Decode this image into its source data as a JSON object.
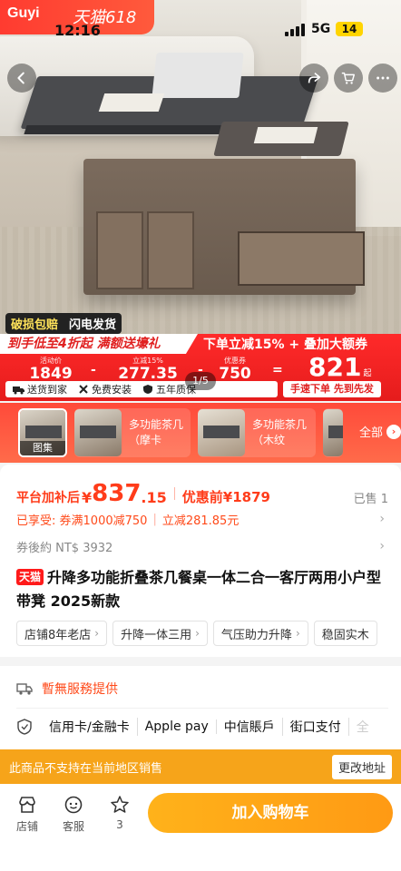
{
  "status_bar": {
    "brand": "Guyi",
    "brand_sub": "天猫618",
    "time": "12:16",
    "network": "5G",
    "battery": "14"
  },
  "hero": {
    "tag_primary": "破损包赔",
    "tag_secondary": "闪电发货",
    "page_indicator": "1/5"
  },
  "promo": {
    "headline_left": "到手低至4折起 满额送壕礼",
    "headline_right": "下单立减15% + 叠加大额券",
    "calc": {
      "activity_label": "活动价",
      "activity_value": "1849",
      "minus1": "-",
      "discount_label": "立减15%",
      "discount_value": "277.35",
      "minus2": "-",
      "coupon_label": "优惠券",
      "coupon_value": "750",
      "equals": "=",
      "final_value": "821",
      "final_unit": "起"
    },
    "perks": [
      "送货到家",
      "免费安装",
      "五年质保"
    ],
    "slogan": "手速下单 先到先发"
  },
  "thumbnails": {
    "first_badge": "图集",
    "items": [
      {
        "caption": "多功能茶几（摩卡"
      },
      {
        "caption": "多功能茶几（木纹"
      }
    ],
    "all_label": "全部"
  },
  "price": {
    "prefix": "平台加补后",
    "symbol": "¥",
    "integer": "837",
    "decimal": ".15",
    "original": "优惠前¥1879",
    "sold": "已售 1"
  },
  "coupon_line": {
    "label": "已享受:",
    "full_reduction": "券满1000减750",
    "instant": "立减281.85元"
  },
  "nt_line": "券後約 NT$ 3932",
  "title": {
    "badge": "天猫",
    "text": "升降多功能折叠茶几餐桌一体二合一客厅两用小户型带凳 2025新款"
  },
  "chips": [
    "店铺8年老店",
    "升降一体三用",
    "气压助力升降",
    "稳固实木"
  ],
  "service": {
    "unavailable": "暫無服務提供",
    "payments": [
      "信用卡/金融卡",
      "Apple pay",
      "中信賬戶",
      "街口支付",
      "全"
    ]
  },
  "notice": {
    "message": "此商品不支持在当前地区销售",
    "button": "更改地址"
  },
  "bottom_bar": {
    "store": "店铺",
    "service": "客服",
    "fav_count": "3",
    "add_to_cart": "加入购物车"
  }
}
